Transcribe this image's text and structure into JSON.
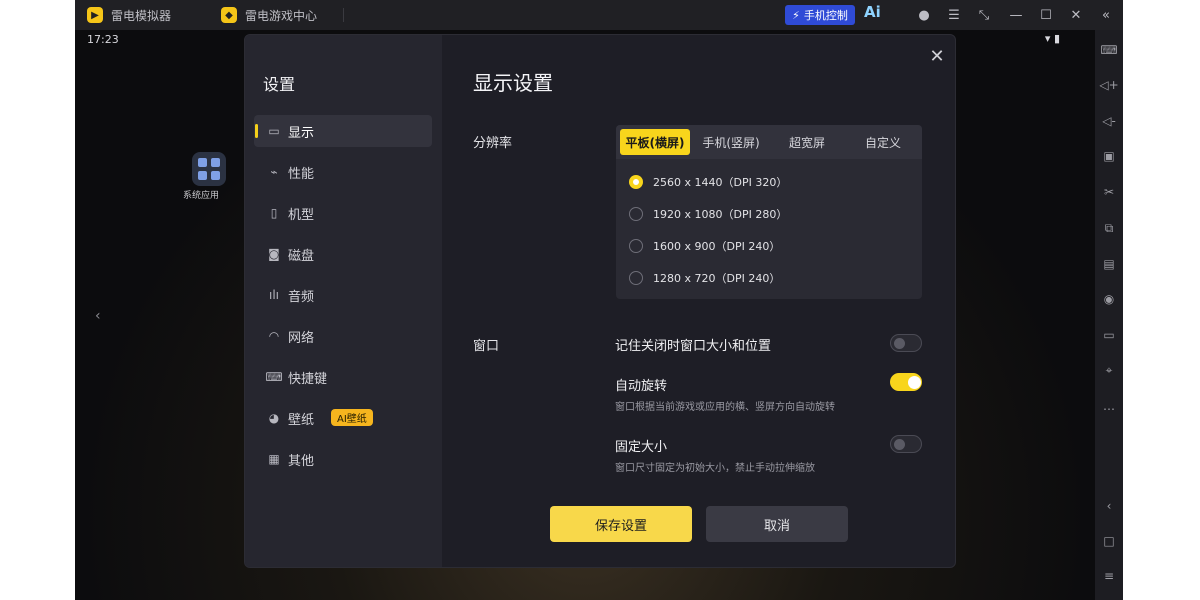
{
  "topbar": {
    "tab1_label": "雷电模拟器",
    "tab2_label": "雷电游戏中心",
    "mobile_control_label": "手机控制",
    "ai_label": "Ai"
  },
  "status": {
    "time": "17:23"
  },
  "desktop": {
    "app_label": "系统应用"
  },
  "dialog": {
    "sidebar_title": "设置",
    "nav": [
      {
        "label": "显示",
        "icon": "monitor-icon"
      },
      {
        "label": "性能",
        "icon": "performance-icon"
      },
      {
        "label": "机型",
        "icon": "phone-icon"
      },
      {
        "label": "磁盘",
        "icon": "disk-icon"
      },
      {
        "label": "音频",
        "icon": "audio-icon"
      },
      {
        "label": "网络",
        "icon": "wifi-icon"
      },
      {
        "label": "快捷键",
        "icon": "keyboard-icon"
      },
      {
        "label": "壁纸",
        "icon": "palette-icon",
        "badge": "AI壁纸"
      },
      {
        "label": "其他",
        "icon": "grid-icon"
      }
    ],
    "title": "显示设置",
    "resolution_label": "分辨率",
    "res_tabs": [
      "平板(横屏)",
      "手机(竖屏)",
      "超宽屏",
      "自定义"
    ],
    "res_options": [
      "2560 x 1440（DPI 320）",
      "1920 x 1080（DPI 280）",
      "1600 x 900（DPI 240）",
      "1280 x 720（DPI 240）"
    ],
    "window_label": "窗口",
    "options": [
      {
        "title": "记住关闭时窗口大小和位置",
        "desc": "",
        "on": false
      },
      {
        "title": "自动旋转",
        "desc": "窗口根据当前游戏或应用的横、竖屏方向自动旋转",
        "on": true
      },
      {
        "title": "固定大小",
        "desc": "窗口尺寸固定为初始大小，禁止手动拉伸缩放",
        "on": false
      }
    ],
    "save_label": "保存设置",
    "cancel_label": "取消"
  },
  "colors": {
    "accent": "#f8d51c",
    "panel": "#1e1e26",
    "sidebar": "#26262f"
  }
}
